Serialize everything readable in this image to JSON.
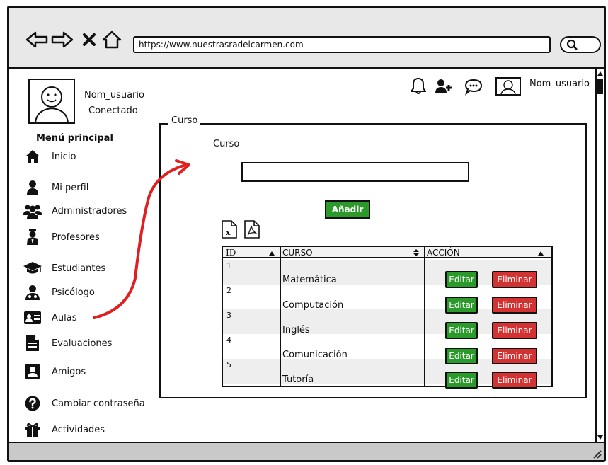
{
  "browser": {
    "url": "https://www.nuestrasradelcarmen.com",
    "nav_icons": [
      "back-arrow-icon",
      "forward-arrow-icon",
      "close-icon",
      "home-icon"
    ],
    "search_icon": "search-icon"
  },
  "user": {
    "name": "Nom_usuario",
    "status": "Conectado",
    "header_name": "Nom_usuario"
  },
  "menu": {
    "title": "Menú principal",
    "items": [
      {
        "label": "Inicio",
        "icon": "home-icon"
      },
      {
        "label": "Mi perfil",
        "icon": "user-icon"
      },
      {
        "label": "Administradores",
        "icon": "users-icon"
      },
      {
        "label": "Profesores",
        "icon": "teacher-icon"
      },
      {
        "label": "Estudiantes",
        "icon": "graduation-cap-icon"
      },
      {
        "label": "Psicólogo",
        "icon": "psychologist-icon"
      },
      {
        "label": "Aulas",
        "icon": "classroom-card-icon"
      },
      {
        "label": "Evaluaciones",
        "icon": "document-icon"
      },
      {
        "label": "Amigos",
        "icon": "contact-icon"
      },
      {
        "label": "Cambiar contraseña",
        "icon": "help-circle-icon"
      },
      {
        "label": "Actividades",
        "icon": "gift-icon"
      }
    ]
  },
  "panel": {
    "legend": "Curso",
    "field_label": "Curso",
    "input_value": "",
    "add_button": "Añadir"
  },
  "table": {
    "headers": [
      "ID",
      "CURSO",
      "ACCIÓN"
    ],
    "rows": [
      {
        "id": "1",
        "curso": "Matemática",
        "edit": "Editar",
        "delete": "Eliminar"
      },
      {
        "id": "2",
        "curso": "Computación",
        "edit": "Editar",
        "delete": "Eliminar"
      },
      {
        "id": "3",
        "curso": "Inglés",
        "edit": "Editar",
        "delete": "Eliminar"
      },
      {
        "id": "4",
        "curso": "Comunicación",
        "edit": "Editar",
        "delete": "Eliminar"
      },
      {
        "id": "5",
        "curso": "Tutoría",
        "edit": "Editar",
        "delete": "Eliminar"
      }
    ]
  },
  "colors": {
    "add_green": "#2b9a2b",
    "edit_green": "#2a9b2a",
    "delete_red": "#d23232",
    "arrow_red": "#e02020"
  }
}
